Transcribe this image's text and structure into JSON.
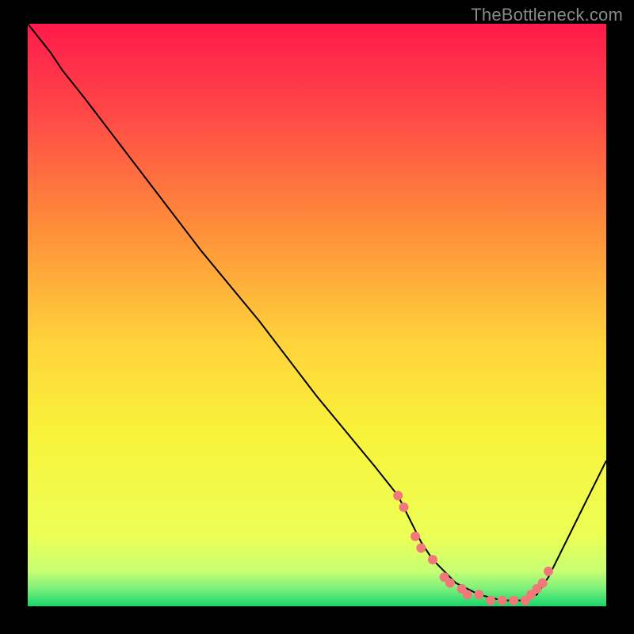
{
  "watermark": "TheBottleneck.com",
  "chart_data": {
    "type": "line",
    "title": "",
    "xlabel": "",
    "ylabel": "",
    "xlim": [
      0,
      100
    ],
    "ylim": [
      0,
      100
    ],
    "grid": false,
    "legend": false,
    "background_gradient_stops": [
      {
        "offset": 0.0,
        "color": "#ff1a4b"
      },
      {
        "offset": 0.15,
        "color": "#ff4747"
      },
      {
        "offset": 0.35,
        "color": "#ff8e3a"
      },
      {
        "offset": 0.55,
        "color": "#ffd43a"
      },
      {
        "offset": 0.7,
        "color": "#f9f23a"
      },
      {
        "offset": 0.88,
        "color": "#ecff55"
      },
      {
        "offset": 0.94,
        "color": "#c7ff73"
      },
      {
        "offset": 0.97,
        "color": "#7bef7b"
      },
      {
        "offset": 1.0,
        "color": "#17d66b"
      }
    ],
    "series": [
      {
        "name": "bottleneck-curve",
        "color": "#000000",
        "stroke_width": 2,
        "x": [
          0,
          4,
          6,
          10,
          20,
          30,
          40,
          50,
          60,
          64,
          66,
          68,
          70,
          74,
          78,
          82,
          86,
          88,
          90,
          92,
          96,
          100
        ],
        "y": [
          100,
          95,
          92,
          87,
          74,
          61,
          49,
          36,
          24,
          19,
          15,
          11,
          8,
          4,
          2,
          1,
          1,
          2,
          5,
          9,
          17,
          25
        ]
      }
    ],
    "markers": {
      "name": "highlight-points",
      "color": "#f07878",
      "radius": 6,
      "x": [
        64,
        65,
        67,
        68,
        70,
        72,
        73,
        75,
        76,
        78,
        80,
        82,
        84,
        86,
        87,
        88,
        89,
        90
      ],
      "y": [
        19,
        17,
        12,
        10,
        8,
        5,
        4,
        3,
        2,
        2,
        1,
        1,
        1,
        1,
        2,
        3,
        4,
        6
      ]
    }
  }
}
